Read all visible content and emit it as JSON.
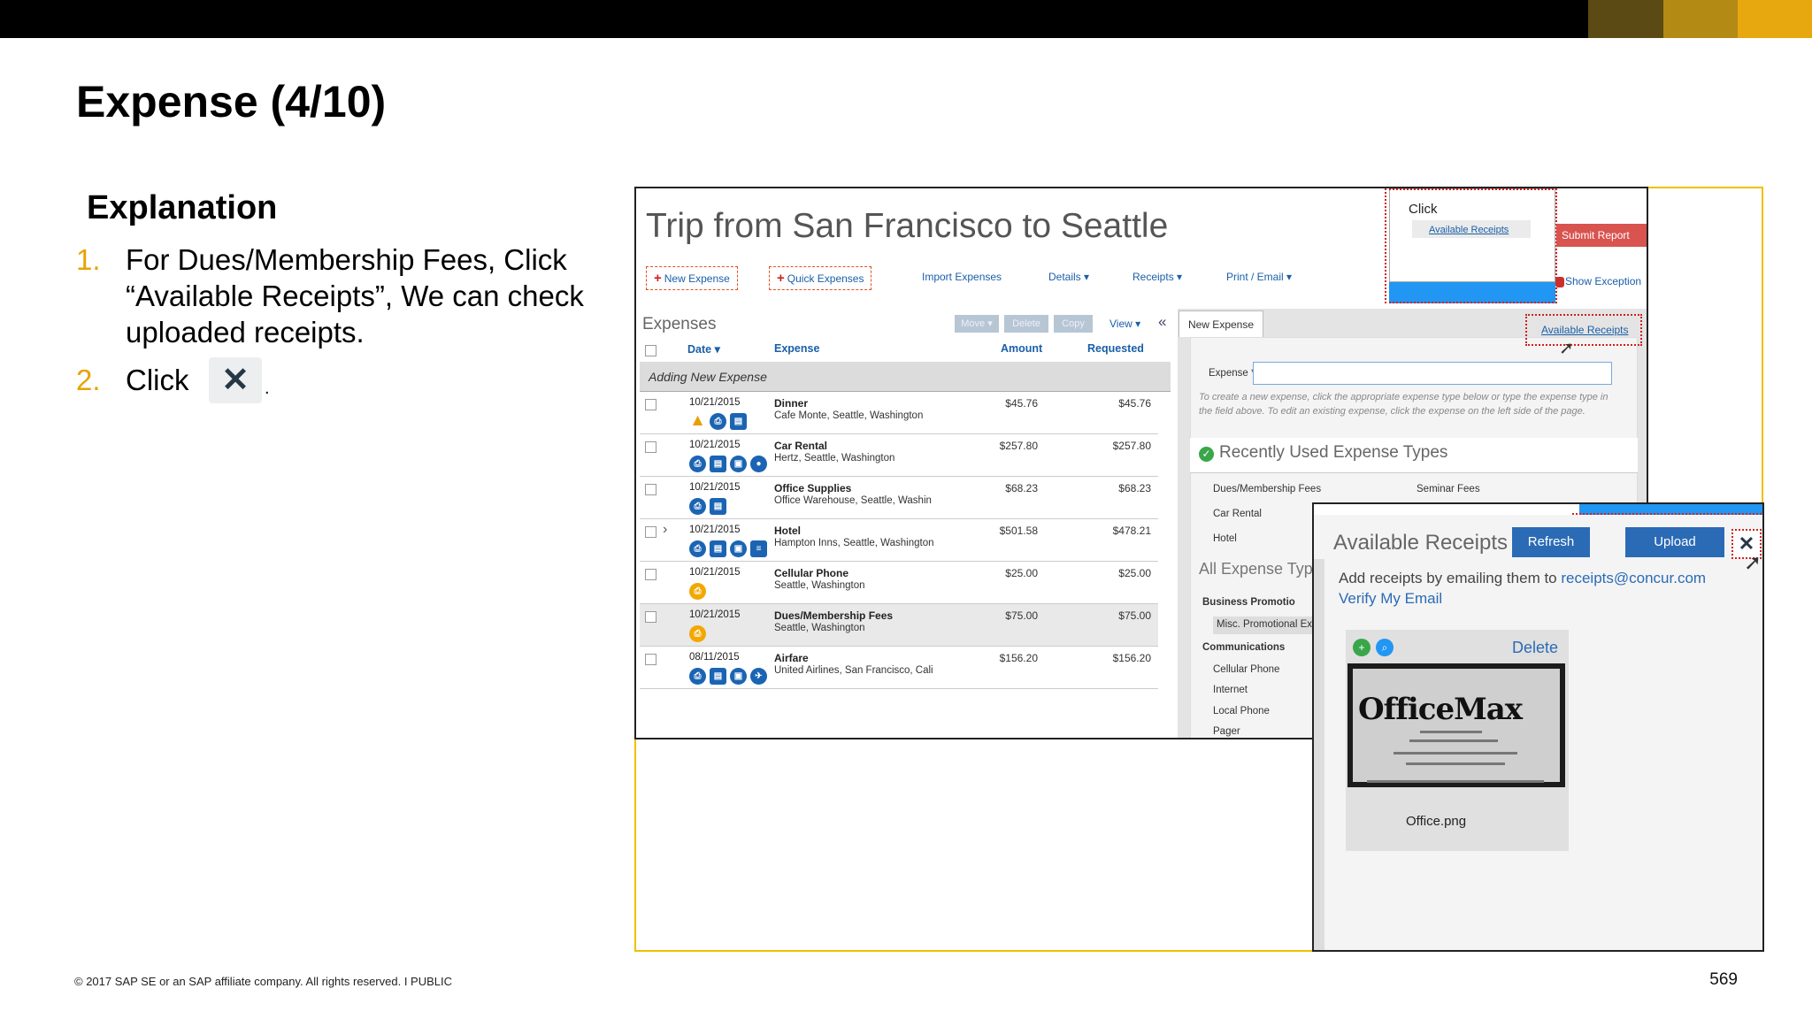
{
  "slide": {
    "title": "Expense (4/10)",
    "explanation_heading": "Explanation",
    "steps": [
      {
        "num": "1.",
        "text": "For Dues/Membership Fees, Click “Available Receipts”, We can check uploaded receipts."
      },
      {
        "num": "2.",
        "text": "Click"
      }
    ],
    "close_glyph": "✕",
    "period": ".",
    "footer": "© 2017 SAP SE or an SAP affiliate company. All rights reserved.   I   PUBLIC",
    "page_number": "569"
  },
  "report": {
    "title": "Trip from San Francisco to Seattle",
    "toolbar": {
      "new_expense": "New Expense",
      "quick_expenses": "Quick Expenses",
      "import_expenses": "Import Expenses",
      "details": "Details ▾",
      "receipts": "Receipts ▾",
      "print_email": "Print / Email ▾"
    },
    "expenses_label": "Expenses",
    "grid_buttons": {
      "move": "Move ▾",
      "delete": "Delete",
      "copy": "Copy",
      "view": "View ▾"
    },
    "collapse_glyph": "«",
    "columns": {
      "date": "Date ▾",
      "expense": "Expense",
      "amount": "Amount",
      "requested": "Requested"
    },
    "adding_row": "Adding New Expense",
    "rows": [
      {
        "date": "10/21/2015",
        "name": "Dinner",
        "location": "Cafe Monte, Seattle, Washington",
        "amount": "$45.76",
        "requested": "$45.76"
      },
      {
        "date": "10/21/2015",
        "name": "Car Rental",
        "location": "Hertz, Seattle, Washington",
        "amount": "$257.80",
        "requested": "$257.80"
      },
      {
        "date": "10/21/2015",
        "name": "Office Supplies",
        "location": "Office Warehouse, Seattle, Washin",
        "amount": "$68.23",
        "requested": "$68.23"
      },
      {
        "date": "10/21/2015",
        "name": "Hotel",
        "location": "Hampton Inns, Seattle, Washington",
        "amount": "$501.58",
        "requested": "$478.21"
      },
      {
        "date": "10/21/2015",
        "name": "Cellular Phone",
        "location": "Seattle, Washington",
        "amount": "$25.00",
        "requested": "$25.00"
      },
      {
        "date": "10/21/2015",
        "name": "Dues/Membership Fees",
        "location": "Seattle, Washington",
        "amount": "$75.00",
        "requested": "$75.00"
      },
      {
        "date": "08/11/2015",
        "name": "Airfare",
        "location": "United Airlines, San Francisco, Cali",
        "amount": "$156.20",
        "requested": "$156.20"
      }
    ],
    "new_expense_tab": "New Expense",
    "expense_field_label": "Expense *",
    "hint": "To create a new expense, click the appropriate expense type below or type the expense type in the field above. To edit an existing expense, click the expense on the left side of the page.",
    "recent_heading": "Recently Used Expense Types",
    "recent_types": [
      "Dues/Membership Fees",
      "Seminar Fees",
      "Car Rental",
      "Hotel"
    ],
    "all_types_heading": "All Expense Typ",
    "categories": {
      "business": "Business Promotio",
      "misc": "Misc. Promotional Ex",
      "communications": "Communications",
      "items": [
        "Cellular Phone",
        "Internet",
        "Local Phone",
        "Pager"
      ]
    },
    "callout_click": "Click",
    "callout_link": "Available Receipts",
    "submit_report": "Submit Report",
    "show_exceptions": "Show Exception",
    "available_receipts_link": "Available Receipts"
  },
  "receipts_panel": {
    "title": "Available Receipts",
    "refresh": "Refresh",
    "upload": "Upload",
    "close": "✕",
    "add_text": "Add receipts by emailing them to ",
    "email": "receipts@concur.com",
    "verify": "Verify My Email",
    "delete": "Delete",
    "receipt_brand": "OfficeMax",
    "filename": "Office.png"
  }
}
